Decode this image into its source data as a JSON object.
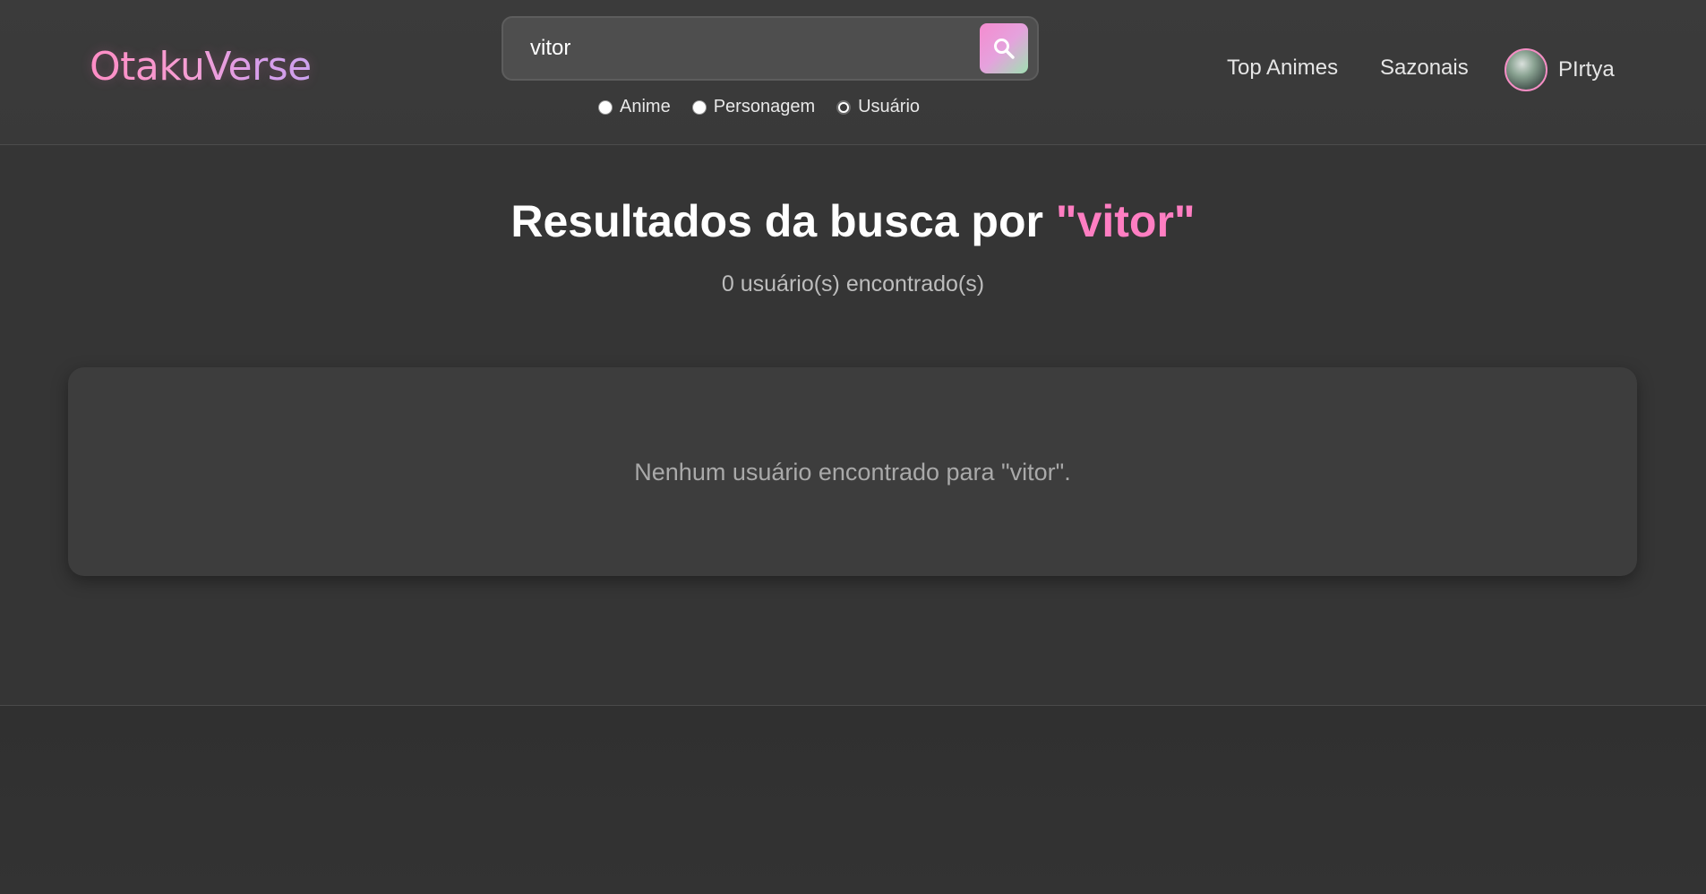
{
  "header": {
    "logo": "OtakuVerse",
    "search": {
      "value": "vitor",
      "placeholder": ""
    },
    "search_types": [
      {
        "label": "Anime",
        "checked": false
      },
      {
        "label": "Personagem",
        "checked": false
      },
      {
        "label": "Usuário",
        "checked": true
      }
    ],
    "nav": {
      "top_animes": "Top Animes",
      "sazonais": "Sazonais"
    },
    "user": {
      "name": "PIrtya"
    }
  },
  "main": {
    "title_prefix": "Resultados da busca por ",
    "title_query": "\"vitor\"",
    "count_text": "0 usuário(s) encontrado(s)",
    "empty_message": "Nenhum usuário encontrado para \"vitor\"."
  },
  "colors": {
    "accent_pink": "#ff7ec2",
    "background": "#353535",
    "card": "#3d3d3d"
  }
}
